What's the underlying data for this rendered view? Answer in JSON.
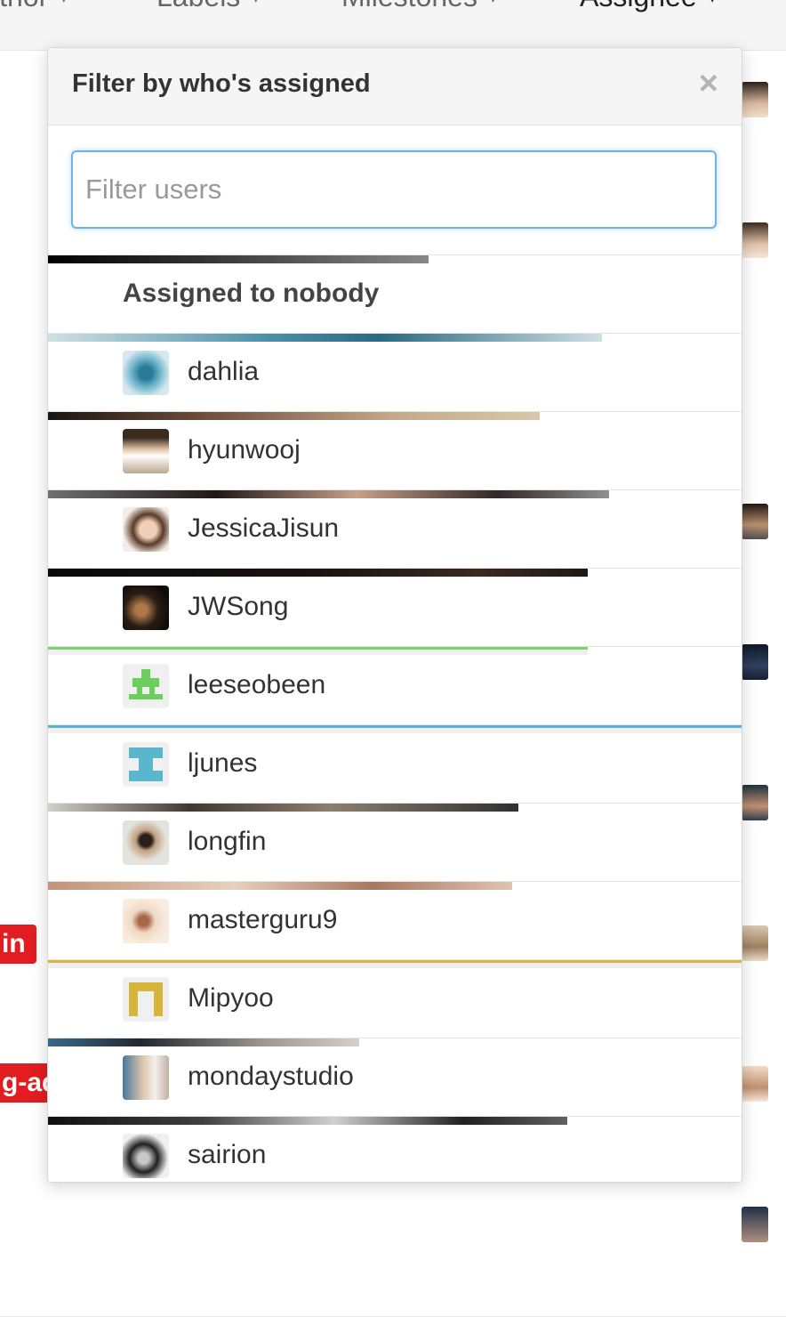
{
  "nav": {
    "tabs": [
      {
        "label": "Author"
      },
      {
        "label": "Labels"
      },
      {
        "label": "Milestones"
      },
      {
        "label": "Assignee"
      }
    ],
    "caret": "▾"
  },
  "labels": [
    "in",
    "g-ad"
  ],
  "dropdown": {
    "title": "Filter by who's assigned",
    "close_icon": "×",
    "filter_placeholder": "Filter users",
    "filter_value": "",
    "nobody_label": "Assigned to nobody",
    "users": [
      {
        "name": "dahlia",
        "color": "#4a8fa8"
      },
      {
        "name": "hyunwooj",
        "color": "#b79a7a"
      },
      {
        "name": "JessicaJisun",
        "color": "#c7a48c"
      },
      {
        "name": "JWSong",
        "color": "#3a2a20"
      },
      {
        "name": "leeseobeen",
        "color": "#6ad05b"
      },
      {
        "name": "ljunes",
        "color": "#59b6cd"
      },
      {
        "name": "longfin",
        "color": "#8a8a80"
      },
      {
        "name": "masterguru9",
        "color": "#d9b59c"
      },
      {
        "name": "Mipyoo",
        "color": "#d7b43a"
      },
      {
        "name": "mondaystudio",
        "color": "#7a8aa0"
      },
      {
        "name": "sairion",
        "color": "#555555"
      }
    ]
  }
}
